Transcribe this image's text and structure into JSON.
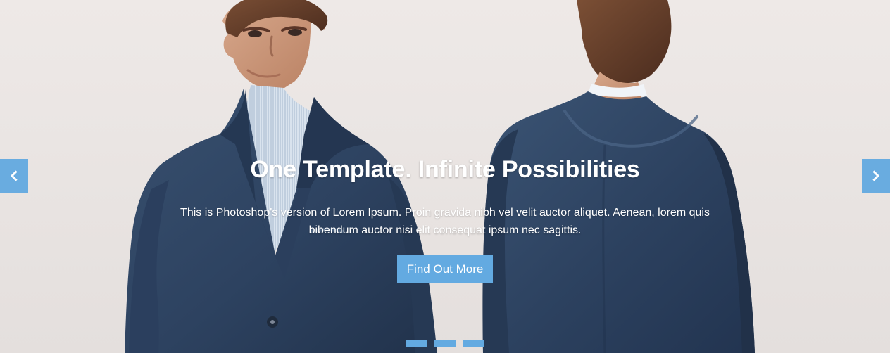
{
  "slider": {
    "headline": "One Template. Infinite Possibilities",
    "description": "This is Photoshop's version of Lorem Ipsum. Proin gravida nibh vel velit auctor aliquet. Aenean, lorem quis bibendum auctor nisi elit consequat ipsum nec sagittis.",
    "cta_label": "Find Out More",
    "prev_icon": "chevron-left-icon",
    "next_icon": "chevron-right-icon",
    "indicator_count": 3,
    "accent_color": "#63aae1",
    "text_color": "#ffffff"
  }
}
